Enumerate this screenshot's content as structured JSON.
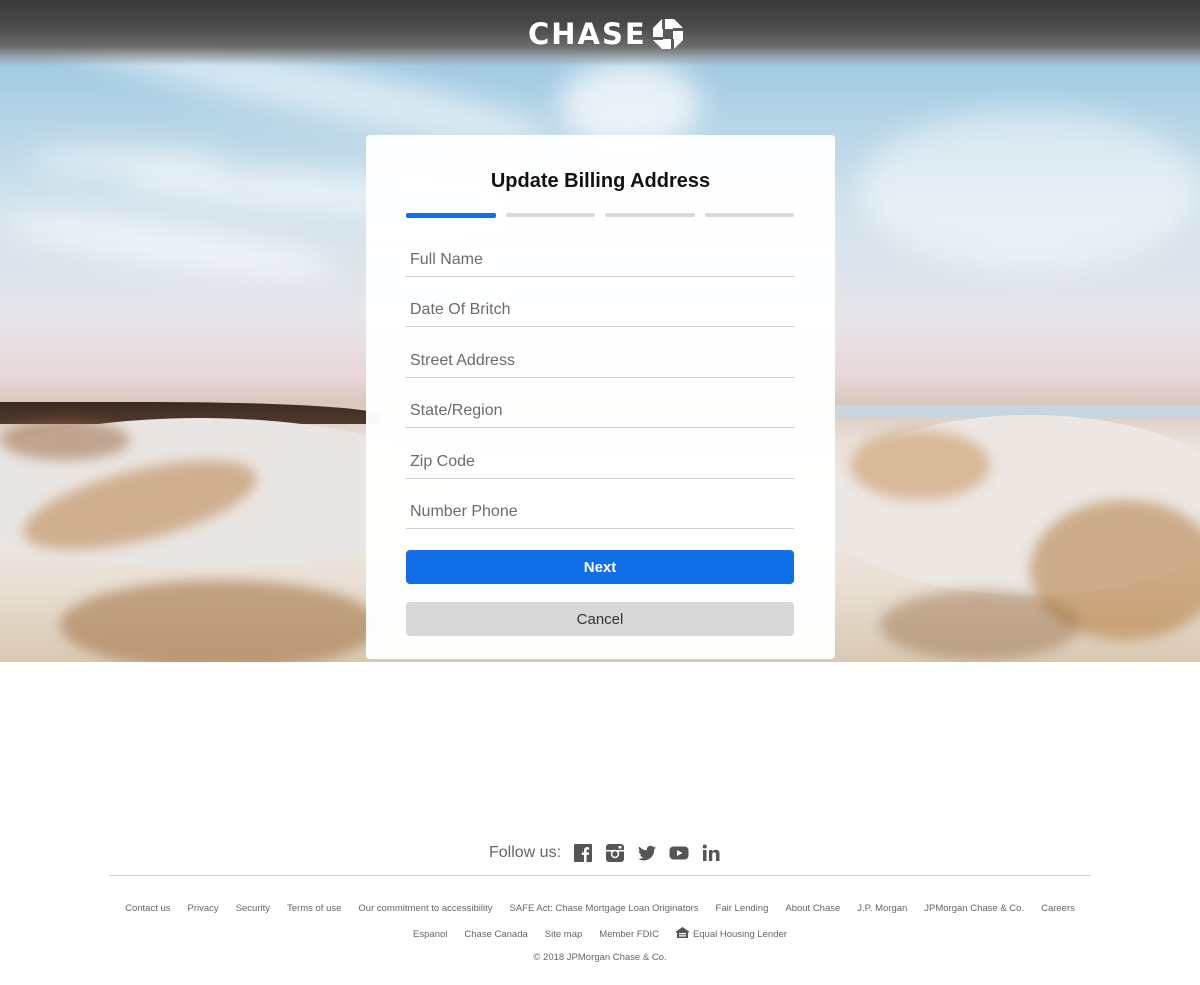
{
  "brand": {
    "name": "CHASE",
    "logo_icon": "chase-octagon-icon",
    "color": "#0f6ee8"
  },
  "form": {
    "title": "Update Billing Address",
    "progress": {
      "total_steps": 4,
      "current_step": 1
    },
    "fields": {
      "full_name": {
        "placeholder": "Full Name",
        "value": ""
      },
      "dob": {
        "placeholder": "Date Of Britch",
        "value": ""
      },
      "street": {
        "placeholder": "Street Address",
        "value": ""
      },
      "state": {
        "placeholder": "State/Region",
        "value": ""
      },
      "zip": {
        "placeholder": "Zip Code",
        "value": ""
      },
      "phone": {
        "placeholder": "Number Phone",
        "value": ""
      }
    },
    "next_label": "Next",
    "cancel_label": "Cancel"
  },
  "footer": {
    "follow_label": "Follow us:",
    "social_icons": [
      "facebook-icon",
      "instagram-icon",
      "twitter-icon",
      "youtube-icon",
      "linkedin-icon"
    ],
    "links_row1": [
      "Contact us",
      "Privacy",
      "Security",
      "Terms of use",
      "Our commitment to accessibility",
      "SAFE Act: Chase Mortgage Loan Originators",
      "Fair Lending",
      "About Chase",
      "J.P. Morgan",
      "JPMorgan Chase & Co.",
      "Careers"
    ],
    "links_row2": [
      "Espanol",
      "Chase Canada",
      "Site map",
      "Member FDIC",
      "Equal Housing Lender"
    ],
    "copyright": "© 2018 JPMorgan Chase & Co."
  }
}
